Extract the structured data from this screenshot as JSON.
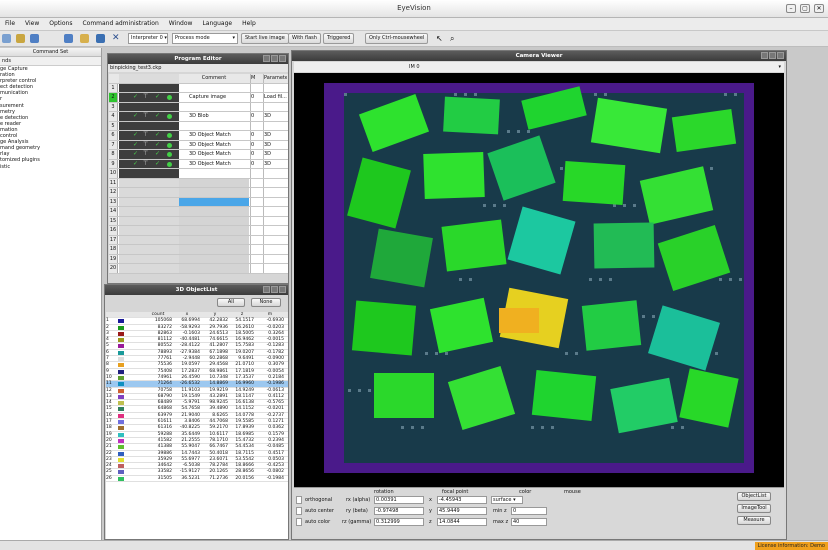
{
  "app": {
    "title": "EyeVision"
  },
  "menu": [
    "File",
    "View",
    "Options",
    "Command administration",
    "Window",
    "Language",
    "Help"
  ],
  "toolbar": {
    "interpreter": "Interpreter 0",
    "mode": "Process mode",
    "start_live": "Start live image",
    "with_flash": "With flash",
    "triggered": "Triggered",
    "ctrl_mousewheel": "Only Ctrl-mousewheel"
  },
  "command_set": {
    "title": "Command Set",
    "tab": "nds",
    "items": [
      "ge Capture",
      "ration",
      "",
      "rpreter control",
      "ect detection",
      "munication",
      "r",
      "surement",
      "metry",
      "e detection",
      "e reader",
      "",
      "mation",
      "control",
      "ge Analysis",
      "mand geometry",
      "rlay",
      "tomized plugins",
      "istic"
    ]
  },
  "program_editor": {
    "title": "Program Editor",
    "file": "binpicking_test3.ckp",
    "col_comment": "Comment",
    "col_m": "M",
    "col_param": "Parameters",
    "rows": [
      {
        "n": "1",
        "cmd": "",
        "m": "",
        "p": ""
      },
      {
        "n": "2",
        "cmd": "Capture image",
        "m": "0",
        "p": "Load fil..."
      },
      {
        "n": "3",
        "cmd": "",
        "m": "",
        "p": ""
      },
      {
        "n": "4",
        "cmd": "3D Blob",
        "m": "0",
        "p": "3D"
      },
      {
        "n": "5",
        "cmd": "",
        "m": "",
        "p": ""
      },
      {
        "n": "6",
        "cmd": "3D Object Match",
        "m": "0",
        "p": "3D"
      },
      {
        "n": "7",
        "cmd": "3D Object Match",
        "m": "0",
        "p": "3D"
      },
      {
        "n": "8",
        "cmd": "3D Object Match",
        "m": "0",
        "p": "3D"
      },
      {
        "n": "9",
        "cmd": "3D Object Match",
        "m": "0",
        "p": "3D"
      },
      {
        "n": "10",
        "cmd": "",
        "m": "",
        "p": ""
      },
      {
        "n": "11",
        "cmd": "",
        "m": "",
        "p": ""
      },
      {
        "n": "12",
        "cmd": "",
        "m": "",
        "p": ""
      },
      {
        "n": "13",
        "cmd": "",
        "m": "",
        "p": ""
      },
      {
        "n": "14",
        "cmd": "",
        "m": "",
        "p": ""
      },
      {
        "n": "15",
        "cmd": "",
        "m": "",
        "p": ""
      },
      {
        "n": "16",
        "cmd": "",
        "m": "",
        "p": ""
      },
      {
        "n": "17",
        "cmd": "",
        "m": "",
        "p": ""
      },
      {
        "n": "18",
        "cmd": "",
        "m": "",
        "p": ""
      },
      {
        "n": "19",
        "cmd": "",
        "m": "",
        "p": ""
      },
      {
        "n": "20",
        "cmd": "",
        "m": "",
        "p": ""
      }
    ]
  },
  "object_list": {
    "title": "3D ObjectList",
    "all": "All",
    "none": "None",
    "columns": [
      "count",
      "x",
      "y",
      "z",
      "m"
    ],
    "rows": [
      [
        "1",
        "105068",
        "68.6994",
        "42.2832",
        "54.1517",
        "-0.6930"
      ],
      [
        "2",
        "83272",
        "-58.9293",
        "29.7936",
        "16.2610",
        "-0.0203"
      ],
      [
        "3",
        "82863",
        "-0.1603",
        "24.6513",
        "18.5005",
        "0.3264"
      ],
      [
        "4",
        "81112",
        "-40.4481",
        "74.6615",
        "16.9462",
        "-0.0015"
      ],
      [
        "5",
        "80552",
        "-28.4122",
        "41.2807",
        "15.7583",
        "-0.1283"
      ],
      [
        "6",
        "78893",
        "-27.9384",
        "67.1898",
        "19.0207",
        "-0.1782"
      ],
      [
        "7",
        "77761",
        "-2.9448",
        "60.2868",
        "9.6491",
        "-0.0900"
      ],
      [
        "8",
        "75536",
        "19.0597",
        "29.4568",
        "21.0710",
        "0.3079"
      ],
      [
        "9",
        "75408",
        "17.2837",
        "68.9861",
        "17.1819",
        "-0.0054"
      ],
      [
        "10",
        "74961",
        "26.4590",
        "10.7348",
        "17.3537",
        "0.2184"
      ],
      [
        "11",
        "71264",
        "-26.6532",
        "14.8869",
        "16.9960",
        "-0.1986"
      ],
      [
        "12",
        "70758",
        "11.9103",
        "19.9219",
        "14.9249",
        "-0.0613"
      ],
      [
        "13",
        "68790",
        "19.1549",
        "43.2891",
        "18.1147",
        "0.4112"
      ],
      [
        "14",
        "68489",
        "-5.9791",
        "98.9245",
        "16.6138",
        "-0.5765"
      ],
      [
        "15",
        "64868",
        "54.7658",
        "39.4890",
        "14.1152",
        "-0.0201"
      ],
      [
        "16",
        "63979",
        "21.9040",
        "8.6265",
        "14.0778",
        "-0.2737"
      ],
      [
        "17",
        "61611",
        "3.8406",
        "44.7068",
        "19.5585",
        "0.1271"
      ],
      [
        "18",
        "61316",
        "-40.8225",
        "59.2170",
        "17.8939",
        "0.0362"
      ],
      [
        "19",
        "59288",
        "35.6449",
        "10.6117",
        "18.6985",
        "0.1579"
      ],
      [
        "20",
        "41582",
        "21.2555",
        "78.1710",
        "15.4732",
        "0.2394"
      ],
      [
        "21",
        "41388",
        "55.9047",
        "66.7467",
        "54.4534",
        "-0.0485"
      ],
      [
        "22",
        "39886",
        "14.7443",
        "50.4018",
        "18.7115",
        "0.4517"
      ],
      [
        "23",
        "35929",
        "55.6977",
        "23.6071",
        "53.5542",
        "0.0503"
      ],
      [
        "24",
        "34642",
        "-6.5038",
        "78.2784",
        "18.8666",
        "-0.4253"
      ],
      [
        "25",
        "33582",
        "-15.9127",
        "20.1265",
        "28.8656",
        "-0.0802"
      ],
      [
        "26",
        "31505",
        "36.5231",
        "71.2736",
        "20.0156",
        "-0.1984"
      ]
    ]
  },
  "camera": {
    "title": "Camera Viewer",
    "channel": "IM 0",
    "orthogonal": "orthogonal",
    "auto_center": "auto center",
    "auto_color": "auto color",
    "rotation": "rotation",
    "rx": "rx (alpha)",
    "rx_val": "0.00391",
    "ry": "ry (beta)",
    "ry_val": "-0.97498",
    "rz": "rz (gamma)",
    "rz_val": "0.312999",
    "focal": "focal point",
    "fx": "-4.45943",
    "fy": "45.9449",
    "fz": "14.0844",
    "color": "color",
    "color_mode": "surface",
    "min_z": "min z",
    "min_val": "0",
    "max_z": "max z",
    "max_val": "40",
    "mouse": "mouse",
    "btn_objlist": "ObjectList",
    "btn_imagetool": "ImageTool",
    "btn_measure": "Measure"
  },
  "status": {
    "license": "License information: Demo"
  },
  "colors": {
    "accent": "#3b6fb5",
    "cloud_green": "#22e832",
    "license": "#f0a01c"
  }
}
